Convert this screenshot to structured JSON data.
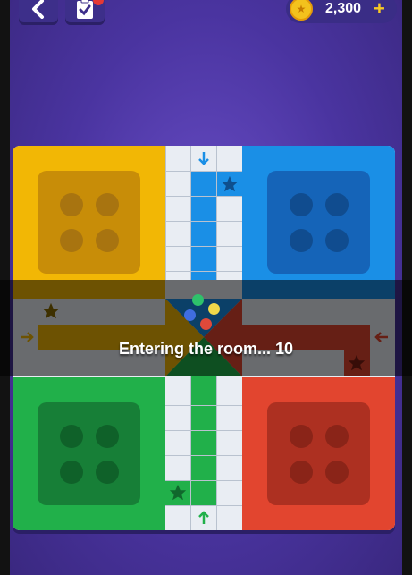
{
  "header": {
    "back_icon": "chevron-left-icon",
    "tasks_icon": "clipboard-check-icon",
    "coins": "2,300",
    "add_icon": "plus-icon"
  },
  "status": {
    "message": "Entering the room...  10"
  },
  "colors": {
    "yellow": "#f2b705",
    "blue": "#1a8fe6",
    "green": "#21b04a",
    "red": "#e2452f"
  }
}
